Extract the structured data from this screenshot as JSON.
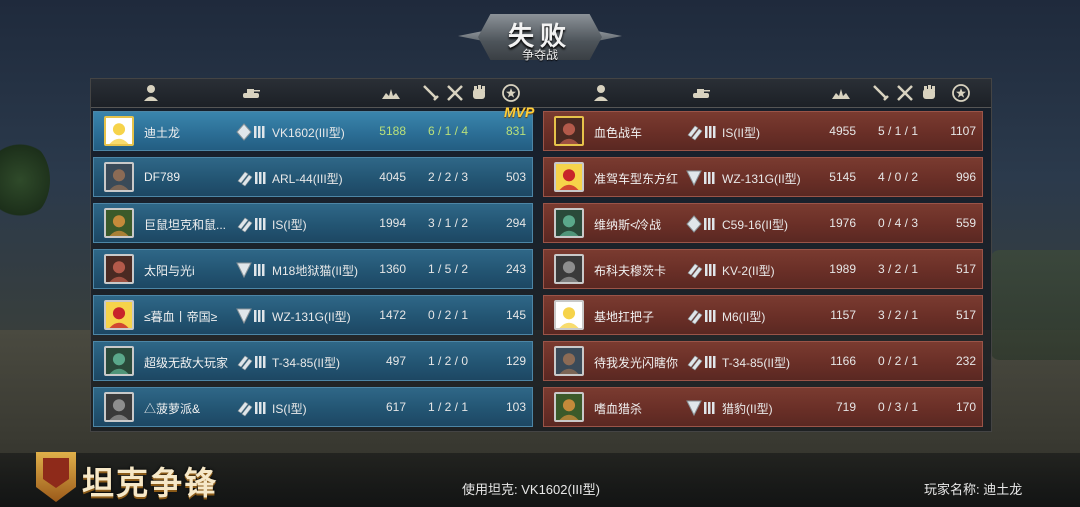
{
  "banner": {
    "title": "失败",
    "subtitle": "争夺战"
  },
  "colors": {
    "blue_team": "#235573",
    "red_team": "#6a2f27",
    "highlight": "#b9e07a",
    "mvp": "#ffcf3a"
  },
  "header_icons": [
    "player-icon",
    "tank-icon",
    "damage-icon",
    "kill-icon",
    "death-icon",
    "assist-icon",
    "score-icon"
  ],
  "mvp_label": "MVP",
  "blue_team": [
    {
      "name": "迪土龙",
      "tank": "VK1602(III型)",
      "damage": "5188",
      "kda": "6 / 1 / 4",
      "score": "831",
      "rank": "diamond",
      "highlight": true
    },
    {
      "name": "DF789",
      "tank": "ARL-44(III型)",
      "damage": "4045",
      "kda": "2 / 2 / 3",
      "score": "503",
      "rank": "chevron"
    },
    {
      "name": "巨鼠坦克和鼠...",
      "tank": "IS(I型)",
      "damage": "1994",
      "kda": "3 / 1 / 2",
      "score": "294",
      "rank": "chevron"
    },
    {
      "name": "太阳与光i",
      "tank": "M18地狱猫(II型)",
      "damage": "1360",
      "kda": "1 / 5 / 2",
      "score": "243",
      "rank": "triangle"
    },
    {
      "name": "≤暮血丨帝国≥",
      "tank": "WZ-131G(II型)",
      "damage": "1472",
      "kda": "0 / 2 / 1",
      "score": "145",
      "rank": "triangle"
    },
    {
      "name": "超级无敌大玩家",
      "tank": "T-34-85(II型)",
      "damage": "497",
      "kda": "1 / 2 / 0",
      "score": "129",
      "rank": "chevron"
    },
    {
      "name": "△菠萝派&",
      "tank": "IS(I型)",
      "damage": "617",
      "kda": "1 / 2 / 1",
      "score": "103",
      "rank": "chevron"
    }
  ],
  "red_team": [
    {
      "name": "血色战车",
      "tank": "IS(II型)",
      "damage": "4955",
      "kda": "5 / 1 / 1",
      "score": "1107",
      "rank": "chevron",
      "mvp": true
    },
    {
      "name": "准驾车型东方红",
      "tank": "WZ-131G(II型)",
      "damage": "5145",
      "kda": "4 / 0 / 2",
      "score": "996",
      "rank": "triangle"
    },
    {
      "name": "维纳斯≮冷战",
      "tank": "C59-16(II型)",
      "damage": "1976",
      "kda": "0 / 4 / 3",
      "score": "559",
      "rank": "diamond"
    },
    {
      "name": "布科夫穆茨卡",
      "tank": "KV-2(II型)",
      "damage": "1989",
      "kda": "3 / 2 / 1",
      "score": "517",
      "rank": "chevron"
    },
    {
      "name": "基地扛把子",
      "tank": "M6(II型)",
      "damage": "1157",
      "kda": "3 / 2 / 1",
      "score": "517",
      "rank": "chevron"
    },
    {
      "name": "待我发光闪瞎你",
      "tank": "T-34-85(II型)",
      "damage": "1166",
      "kda": "0 / 2 / 1",
      "score": "232",
      "rank": "chevron"
    },
    {
      "name": "嗜血猎杀",
      "tank": "猎豹(II型)",
      "damage": "719",
      "kda": "0 / 3 / 1",
      "score": "170",
      "rank": "triangle"
    }
  ],
  "footer": {
    "logo_text": "坦克争锋",
    "tank_used": "使用坦克: VK1602(III型)",
    "player_name": "玩家名称: 迪土龙"
  }
}
